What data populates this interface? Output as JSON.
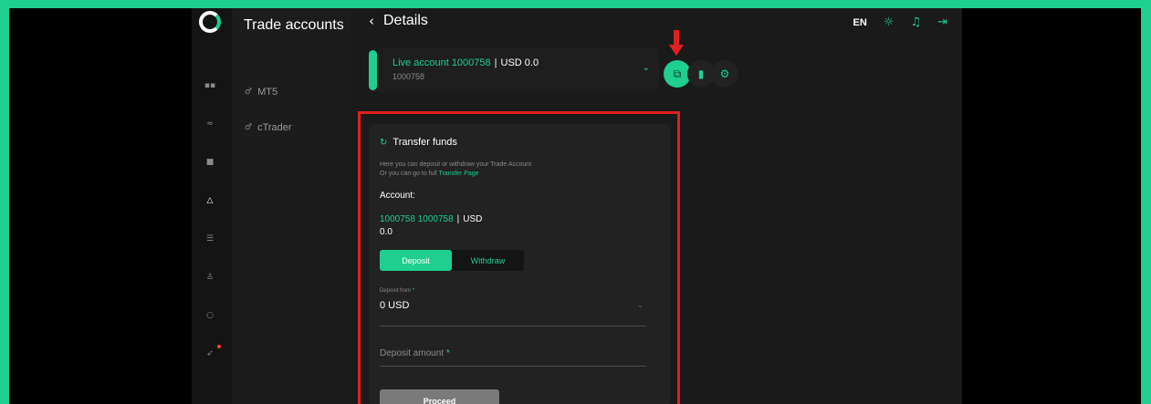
{
  "sidebar": {
    "title": "Trade accounts",
    "items": [
      {
        "label": "MT5"
      },
      {
        "label": "cTrader"
      }
    ]
  },
  "rail_icons": [
    "grid-icon",
    "chart-icon",
    "wallet-icon",
    "trade-icon",
    "list-icon",
    "user-icon",
    "chat-icon",
    "rocket-icon"
  ],
  "header": {
    "back_label": "Details",
    "language": "EN"
  },
  "account_selector": {
    "name": "Live account 1000758",
    "separator": "|",
    "balance": "USD 0.0",
    "number": "1000758"
  },
  "transfer": {
    "title": "Transfer funds",
    "desc_line1": "Here you can deposit or withdraw your Trade Account",
    "desc_line2_prefix": "Or you can go to full ",
    "desc_link": "Transfer Page",
    "account_label": "Account:",
    "account_number": "1000758 1000758",
    "account_sep": "|",
    "account_currency": "USD",
    "account_balance": "0.0",
    "tabs": [
      {
        "label": "Deposit"
      },
      {
        "label": "Withdraw"
      }
    ],
    "deposit_from_label": "Deposit from",
    "deposit_from_value": "0 USD",
    "deposit_amount_label": "Deposit amount",
    "required_mark": "*",
    "proceed_label": "Proceed"
  },
  "colors": {
    "accent": "#1ecf8f",
    "highlight": "#e02020",
    "background": "#1a1a1a"
  }
}
